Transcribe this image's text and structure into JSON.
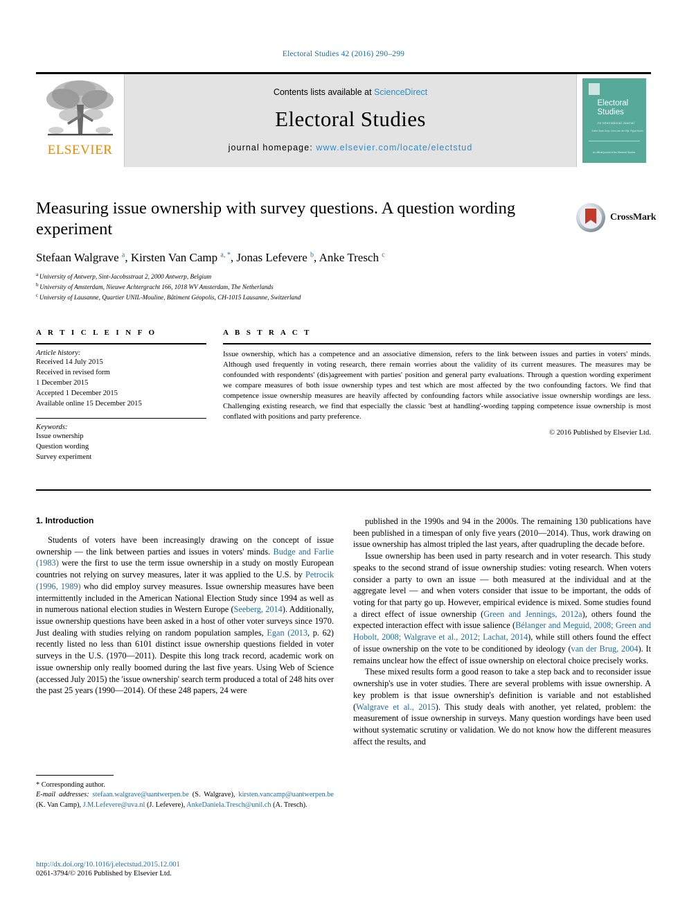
{
  "running_head": "Electoral Studies 42 (2016) 290–299",
  "masthead": {
    "publisher_name": "ELSEVIER",
    "contents_prefix": "Contents lists available at ",
    "sciencedirect": "ScienceDirect",
    "journal_title": "Electoral Studies",
    "homepage_label": "journal homepage: ",
    "homepage_url": "www.elsevier.com/locate/electstud",
    "cover": {
      "title_line1": "Electoral",
      "title_line2": "Studies",
      "subtitle": "An International Journal",
      "editors": "Editor\nMark Gray, Cees van der Eijk, Pippa Norris",
      "footer": "An official journal of the\nElectoral Studies"
    }
  },
  "article": {
    "title": "Measuring issue ownership with survey questions. A question wording experiment",
    "authors": [
      {
        "name": "Stefaan Walgrave",
        "sup": "a"
      },
      {
        "name": "Kirsten Van Camp",
        "sup": "a, *"
      },
      {
        "name": "Jonas Lefevere",
        "sup": "b"
      },
      {
        "name": "Anke Tresch",
        "sup": "c"
      }
    ],
    "affiliations": [
      {
        "mark": "a",
        "text": "University of Antwerp, Sint-Jacobsstraat 2, 2000 Antwerp, Belgium"
      },
      {
        "mark": "b",
        "text": "University of Amsterdam, Nieuwe Achtergracht 166, 1018 WV Amsterdam, The Netherlands"
      },
      {
        "mark": "c",
        "text": "University of Lausanne, Quartier UNIL-Mouline, Bâtiment Géopolis, CH-1015 Lausanne, Switzerland"
      }
    ],
    "crossmark_label": "CrossMark"
  },
  "article_info": {
    "heading": "A R T I C L E   I N F O",
    "history_label": "Article history:",
    "history": [
      "Received 14 July 2015",
      "Received in revised form",
      "1 December 2015",
      "Accepted 1 December 2015",
      "Available online 15 December 2015"
    ],
    "keywords_label": "Keywords:",
    "keywords": [
      "Issue ownership",
      "Question wording",
      "Survey experiment"
    ]
  },
  "abstract": {
    "heading": "A B S T R A C T",
    "text": "Issue ownership, which has a competence and an associative dimension, refers to the link between issues and parties in voters' minds. Although used frequently in voting research, there remain worries about the validity of its current measures. The measures may be confounded with respondents' (dis)agreement with parties' position and general party evaluations. Through a question wording experiment we compare measures of both issue ownership types and test which are most affected by the two confounding factors. We find that competence issue ownership measures are heavily affected by confounding factors while associative issue ownership wordings are less. Challenging existing research, we find that especially the classic 'best at handling'-wording tapping competence issue ownership is most conflated with positions and party preference.",
    "copyright": "© 2016 Published by Elsevier Ltd."
  },
  "body": {
    "section_title": "1. Introduction",
    "left_paragraphs": [
      "Students of voters have been increasingly drawing on the concept of issue ownership — the link between parties and issues in voters' minds. Budge and Farlie (1983) were the first to use the term issue ownership in a study on mostly European countries not relying on survey measures, later it was applied to the U.S. by Petrocik (1996, 1989) who did employ survey measures. Issue ownership measures have been intermittently included in the American National Election Study since 1994 as well as in numerous national election studies in Western Europe (Seeberg, 2014). Additionally, issue ownership questions have been asked in a host of other voter surveys since 1970. Just dealing with studies relying on random population samples, Egan (2013, p. 62) recently listed no less than 6101 distinct issue ownership questions fielded in voter surveys in the U.S. (1970—2011). Despite this long track record, academic work on issue ownership only really boomed during the last five years. Using Web of Science (accessed July 2015) the 'issue ownership' search term produced a total of 248 hits over the past 25 years (1990—2014). Of these 248 papers, 24 were"
    ],
    "right_paragraphs": [
      "published in the 1990s and 94 in the 2000s. The remaining 130 publications have been published in a timespan of only five years (2010—2014). Thus, work drawing on issue ownership has almost tripled the last years, after quadrupling the decade before.",
      "Issue ownership has been used in party research and in voter research. This study speaks to the second strand of issue ownership studies: voting research. When voters consider a party to own an issue — both measured at the individual and at the aggregate level — and when voters consider that issue to be important, the odds of voting for that party go up. However, empirical evidence is mixed. Some studies found a direct effect of issue ownership (Green and Jennings, 2012a), others found the expected interaction effect with issue salience (Bélanger and Meguid, 2008; Green and Hobolt, 2008; Walgrave et al., 2012; Lachat, 2014), while still others found the effect of issue ownership on the vote to be conditioned by ideology (van der Brug, 2004). It remains unclear how the effect of issue ownership on electoral choice precisely works.",
      "These mixed results form a good reason to take a step back and to reconsider issue ownership's use in voter studies. There are several problems with issue ownership. A key problem is that issue ownership's definition is variable and not established (Walgrave et al., 2015). This study deals with another, yet related, problem: the measurement of issue ownership in surveys. Many question wordings have been used without systematic scrutiny or validation. We do not know how the different measures affect the results, and"
    ]
  },
  "footnotes": {
    "corresponding": "* Corresponding author.",
    "email_label": "E-mail addresses:",
    "emails": [
      {
        "address": "stefaan.walgrave@uantwerpen.be",
        "person": "(S. Walgrave)"
      },
      {
        "address": "kirsten.vancamp@uantwerpen.be",
        "person": "(K. Van Camp)"
      },
      {
        "address": "J.M.Lefevere@uva.nl",
        "person": "(J. Lefevere)"
      },
      {
        "address": "AnkeDaniela.Tresch@unil.ch",
        "person": "(A. Tresch)."
      }
    ],
    "doi": "http://dx.doi.org/10.1016/j.electstud.2015.12.001",
    "issn": "0261-3794/© 2016 Published by Elsevier Ltd."
  },
  "colors": {
    "link": "#1b6ca8",
    "sciencedirect": "#2b8ccc",
    "elsevier_orange": "#f08700",
    "cover_teal": "#57a99a",
    "crossmark_red": "#c0392b"
  }
}
